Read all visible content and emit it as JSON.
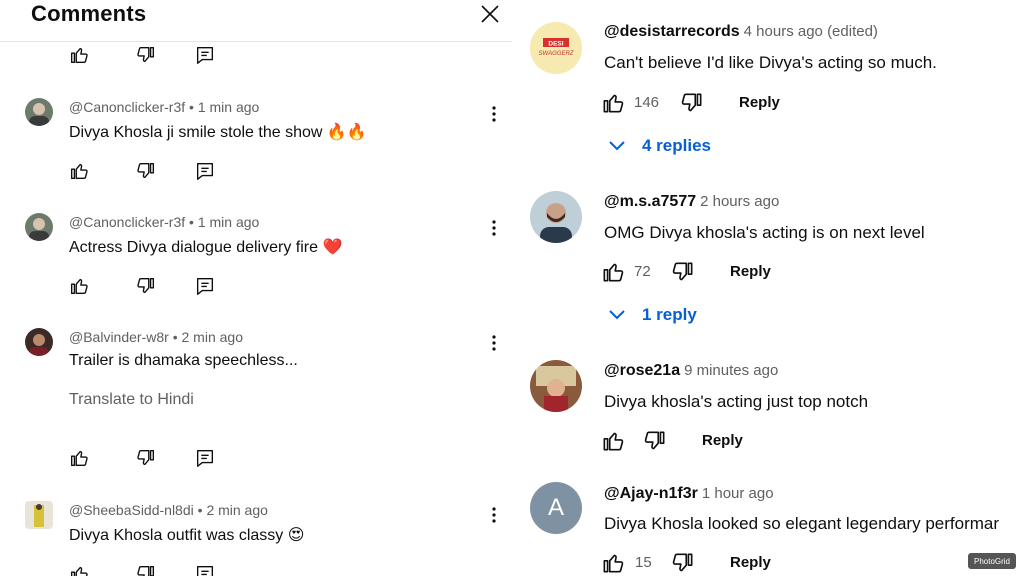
{
  "left": {
    "title": "Comments",
    "comments": [
      {
        "handle": "@Canonclicker-r3f",
        "time": "1 min ago",
        "text": "Divya Khosla ji smile stole the show 🔥🔥"
      },
      {
        "handle": "@Canonclicker-r3f",
        "time": "1 min ago",
        "text": "Actress Divya dialogue delivery fire ❤️"
      },
      {
        "handle": "@Balvinder-w8r",
        "time": "2 min ago",
        "text": "Trailer is dhamaka speechless...",
        "translate": "Translate to Hindi"
      },
      {
        "handle": "@SheebaSidd-nl8di",
        "time": "2 min ago",
        "text": "Divya Khosla outfit was classy 😍"
      }
    ],
    "separator": " • "
  },
  "right": {
    "comments": [
      {
        "handle": "@desistarrecords",
        "time": "4 hours ago (edited)",
        "text": "Can't believe I'd like Divya's acting so much.",
        "likes": "146",
        "reply_label": "Reply",
        "replies_label": "4 replies",
        "avatar_text_1": "DESI",
        "avatar_text_2": "SWAGGERZ"
      },
      {
        "handle": "@m.s.a7577",
        "time": "2 hours ago",
        "text": "OMG Divya khosla's acting is on next level",
        "likes": "72",
        "reply_label": "Reply",
        "replies_label": "1 reply"
      },
      {
        "handle": "@rose21a",
        "time": "9 minutes ago",
        "text": "Divya khosla's acting just top notch",
        "likes": "",
        "reply_label": "Reply"
      },
      {
        "handle": "@Ajay-n1f3r",
        "time": "1 hour ago",
        "text": "Divya Khosla looked so elegant legendary performar",
        "likes": "15",
        "reply_label": "Reply",
        "avatar_letter": "A"
      }
    ]
  },
  "watermark": "PhotoGrid",
  "colors": {
    "link": "#065fd4",
    "meta": "#606060",
    "text": "#0f0f0f",
    "divider": "#e5e5e5"
  }
}
